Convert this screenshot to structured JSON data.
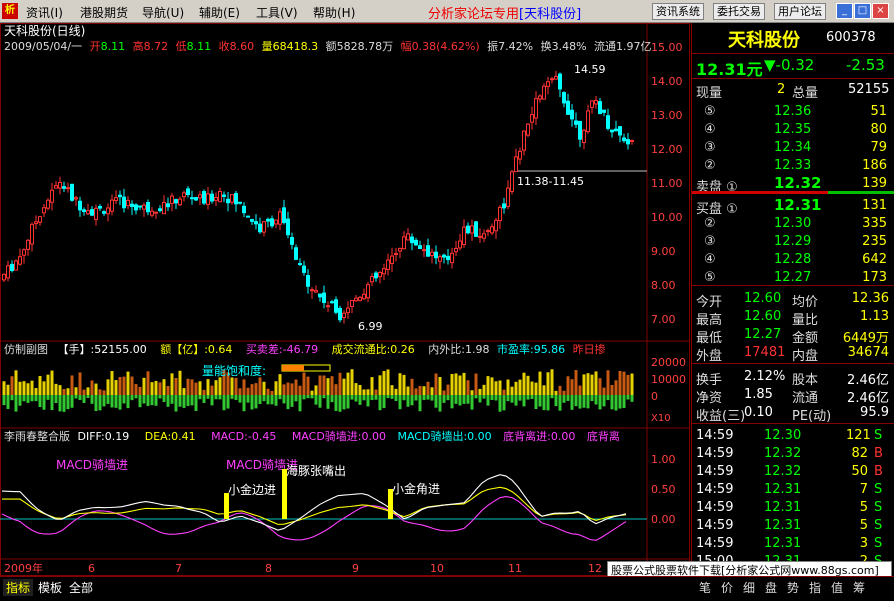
{
  "menu": {
    "items": [
      "资讯(I)",
      "港股期货",
      "导航(U)",
      "辅助(E)",
      "工具(V)",
      "帮助(H)"
    ],
    "brand_prefix": "分析家论坛专用",
    "brand_stock": "[天科股份]",
    "buttons": [
      "资讯系统",
      "委托交易",
      "用户论坛"
    ]
  },
  "colors": {
    "up": "#ff3232",
    "down": "#00ffff",
    "vol_up": "#e6d200",
    "vol_down": "#32c832",
    "ma": "#ffffff"
  },
  "main_chart": {
    "title": "天科股份(日线)",
    "info": {
      "date": "2009/05/04/一",
      "open_label": "开",
      "open": "8.11",
      "high_label": "高",
      "high": "8.72",
      "low_label": "低",
      "low": "8.11",
      "close_label": "收",
      "close": "8.60",
      "vol_label": "量",
      "vol": "68418.3",
      "amt_label": "额",
      "amt": "5828.78万",
      "chg_label": "幅",
      "chg": "0.38(4.62%)",
      "amp_label": "振",
      "amp": "7.42%",
      "turn_label": "换",
      "turn": "3.48%",
      "float_label": "流通",
      "float": "1.97亿"
    },
    "annotations": {
      "high": "14.59",
      "low": "6.99",
      "range": "11.38-11.45"
    },
    "y_ticks": [
      "15.00",
      "14.00",
      "13.00",
      "12.00",
      "11.00",
      "10.00",
      "9.00",
      "8.00",
      "7.00"
    ]
  },
  "volume_panel": {
    "label": "仿制副图",
    "vol_label": "【手】:52155.00",
    "amt_label": "额【亿】:0.64",
    "bs_label": "买卖差:-46.79",
    "flow_label": "成交流通比:0.26",
    "io_label": "内外比:1.98",
    "pe_label": "市盈率:95.86",
    "yest_label": "昨日掺",
    "annotation": "量能饱和度:",
    "y_ticks": [
      "20000",
      "10000",
      "0"
    ],
    "scale": "X10"
  },
  "macd_panel": {
    "label": "李雨春整合版",
    "diff": "DIFF:0.19",
    "dea": "DEA:0.41",
    "macd": "MACD:-0.45",
    "buy_up": "MACD骑墙进:0.00",
    "buy_out": "MACD骑墙出:0.00",
    "top_div": "底背离进:0.00",
    "top_div2": "底背离",
    "notes": [
      "MACD骑墙进",
      "MACD骑墙进",
      "小金边进",
      "海豚张嘴出",
      "小金角进"
    ],
    "y_ticks": [
      "1.00",
      "0.50",
      "0.00"
    ]
  },
  "x_axis": {
    "months": [
      "2009年",
      "6",
      "7",
      "8",
      "9",
      "10",
      "11",
      "12"
    ]
  },
  "quote": {
    "name": "天科股份",
    "code": "600378",
    "price": "12.31元",
    "change": "▼-0.32",
    "change2": "-2.53",
    "cur_vol_label": "现量",
    "cur_vol": "2",
    "total_vol_label": "总量",
    "total_vol": "52155",
    "sell": [
      {
        "lvl": "⑤",
        "p": "12.36",
        "v": "51"
      },
      {
        "lvl": "④",
        "p": "12.35",
        "v": "80"
      },
      {
        "lvl": "③",
        "p": "12.34",
        "v": "79"
      },
      {
        "lvl": "②",
        "p": "12.33",
        "v": "186"
      },
      {
        "lvl": "卖盘 ①",
        "p": "12.32",
        "v": "139"
      }
    ],
    "buy": [
      {
        "lvl": "买盘 ①",
        "p": "12.31",
        "v": "131"
      },
      {
        "lvl": "②",
        "p": "12.30",
        "v": "335"
      },
      {
        "lvl": "③",
        "p": "12.29",
        "v": "235"
      },
      {
        "lvl": "④",
        "p": "12.28",
        "v": "642"
      },
      {
        "lvl": "⑤",
        "p": "12.27",
        "v": "173"
      }
    ],
    "stats": [
      {
        "a": "今开",
        "av": "12.60",
        "b": "均价",
        "bv": "12.36"
      },
      {
        "a": "最高",
        "av": "12.60",
        "b": "量比",
        "bv": "1.13"
      },
      {
        "a": "最低",
        "av": "12.27",
        "b": "金额",
        "bv": "6449万"
      },
      {
        "a": "外盘",
        "av": "17481",
        "b": "内盘",
        "bv": "34674"
      }
    ],
    "stats2": [
      {
        "a": "换手",
        "av": "2.12%",
        "b": "股本",
        "bv": "2.46亿"
      },
      {
        "a": "净资",
        "av": "1.85",
        "b": "流通",
        "bv": "2.46亿"
      },
      {
        "a": "收益(三)",
        "av": "0.10",
        "b": "PE(动)",
        "bv": "95.9"
      }
    ],
    "ticks": [
      {
        "t": "14:59",
        "p": "12.30",
        "v": "121",
        "s": "S"
      },
      {
        "t": "14:59",
        "p": "12.32",
        "v": "82",
        "s": "B"
      },
      {
        "t": "14:59",
        "p": "12.32",
        "v": "50",
        "s": "B"
      },
      {
        "t": "14:59",
        "p": "12.31",
        "v": "7",
        "s": "S"
      },
      {
        "t": "14:59",
        "p": "12.31",
        "v": "5",
        "s": "S"
      },
      {
        "t": "14:59",
        "p": "12.31",
        "v": "5",
        "s": "S"
      },
      {
        "t": "14:59",
        "p": "12.31",
        "v": "3",
        "s": "S"
      },
      {
        "t": "15:00",
        "p": "12.31",
        "v": "2",
        "s": "S"
      }
    ]
  },
  "bottom_tabs": [
    "指标",
    "模板",
    "全部"
  ],
  "right_tabs": [
    "笔",
    "价",
    "细",
    "盘",
    "势",
    "指",
    "值",
    "筹"
  ],
  "ad_text": "股票公式股票软件下载[分析家公式网www.88gs.com]"
}
